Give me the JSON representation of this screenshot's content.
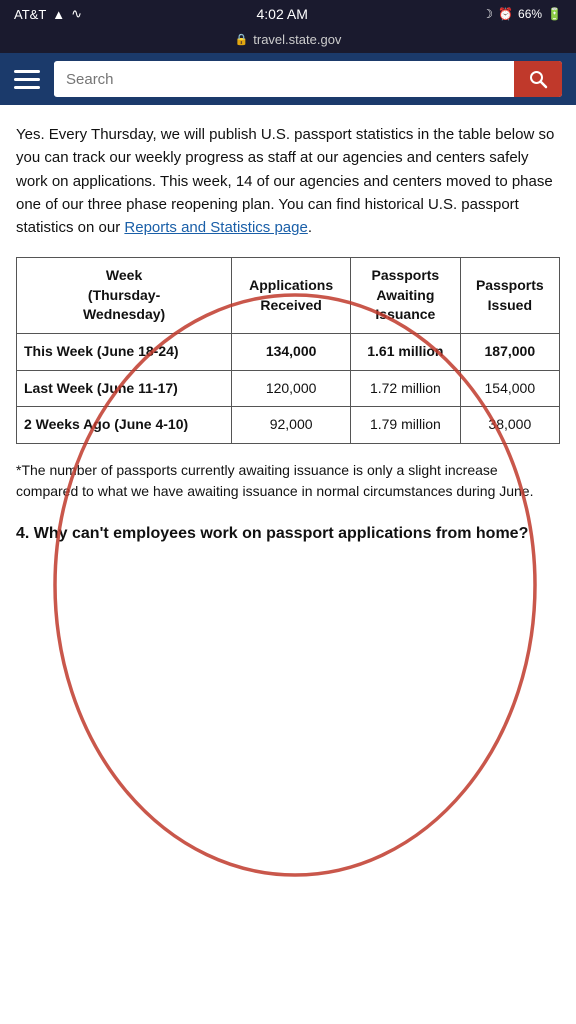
{
  "statusBar": {
    "carrier": "AT&T",
    "time": "4:02 AM",
    "battery": "66%",
    "url": "travel.state.gov"
  },
  "nav": {
    "searchPlaceholder": "Search"
  },
  "content": {
    "introParagraph": "Yes. Every Thursday, we will publish U.S. passport statistics in the table below so you can track our weekly progress as staff at our agencies and centers safely work on applications. This week, 14 of our agencies and centers moved to phase one of our three phase reopening plan. You can find historical U.S. passport statistics on our ",
    "linkText": "Reports and Statistics page",
    "introPeriod": ".",
    "table": {
      "headers": [
        "Week (Thursday-Wednesday)",
        "Applications Received",
        "Passports Awaiting Issuance",
        "Passports Issued"
      ],
      "rows": [
        {
          "week": "This Week (June 18-24)",
          "applications": "134,000",
          "awaiting": "1.61 million",
          "issued": "187,000"
        },
        {
          "week": "Last Week (June 11-17)",
          "applications": "120,000",
          "awaiting": "1.72 million",
          "issued": "154,000"
        },
        {
          "week": "2 Weeks Ago (June 4-10)",
          "applications": "92,000",
          "awaiting": "1.79 million",
          "issued": "38,000"
        }
      ]
    },
    "footnote": "*The number of passports currently awaiting issuance is only a slight increase compared to what we have awaiting issuance in normal circumstances during June.",
    "sectionHeading": "4. Why can't employees work on passport applications from home?"
  }
}
